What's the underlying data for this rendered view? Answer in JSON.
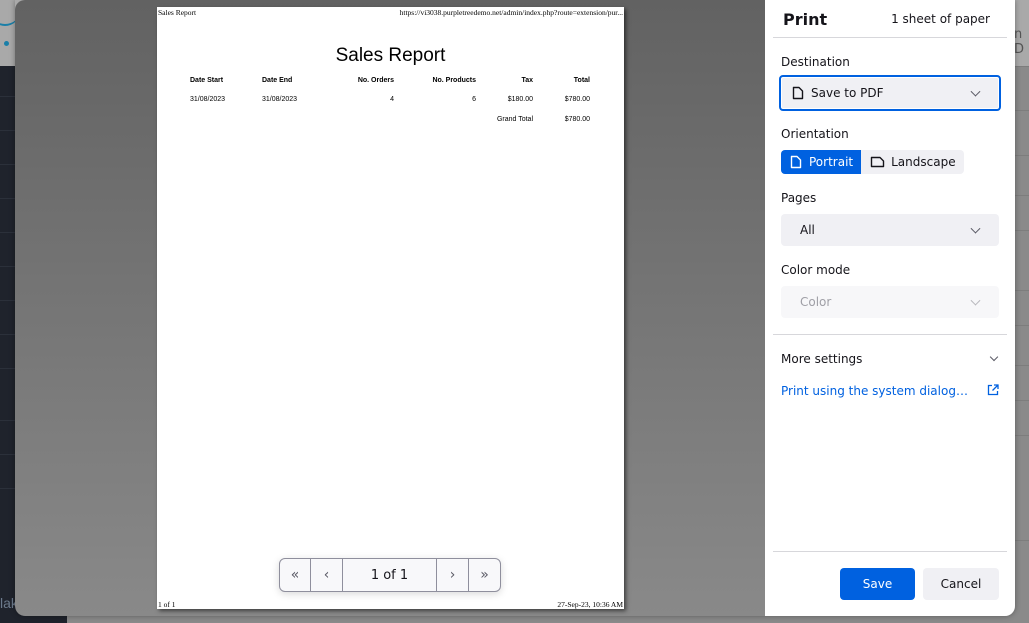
{
  "background": {
    "sidebar_text": "lak",
    "right_text": "n D"
  },
  "preview": {
    "sheet": {
      "header_left": "Sales Report",
      "header_right": "https://vi3038.purpletreedemo.net/admin/index.php?route=extension/pur...",
      "footer_left": "1 of 1",
      "footer_right": "27-Sep-23, 10:36 AM",
      "report": {
        "title": "Sales Report",
        "columns": [
          "Date Start",
          "Date End",
          "No. Orders",
          "No. Products",
          "Tax",
          "Total"
        ],
        "rows": [
          [
            "31/08/2023",
            "31/08/2023",
            "4",
            "6",
            "$180.00",
            "$780.00"
          ]
        ],
        "grand_total_label": "Grand Total",
        "grand_total_value": "$780.00"
      }
    },
    "pager": {
      "first_icon": "«",
      "prev_icon": "‹",
      "label": "1 of 1",
      "next_icon": "›",
      "last_icon": "»"
    }
  },
  "panel": {
    "title": "Print",
    "sheet_count": "1 sheet of paper",
    "destination": {
      "label": "Destination",
      "value": "Save to PDF"
    },
    "orientation": {
      "label": "Orientation",
      "options": [
        "Portrait",
        "Landscape"
      ],
      "selected": "Portrait"
    },
    "pages": {
      "label": "Pages",
      "value": "All"
    },
    "color_mode": {
      "label": "Color mode",
      "value": "Color",
      "disabled": true
    },
    "more_settings": "More settings",
    "system_dialog_link": "Print using the system dialog…",
    "save_label": "Save",
    "cancel_label": "Cancel"
  },
  "colors": {
    "accent": "#0061e0",
    "panel_bg": "#ffffff",
    "control_bg": "#f0f0f4"
  }
}
